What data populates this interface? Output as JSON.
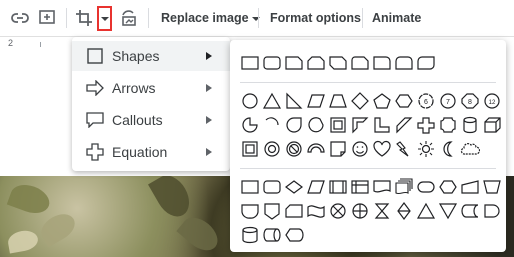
{
  "toolbar": {
    "replace_image": "Replace image",
    "format_options": "Format options",
    "animate": "Animate"
  },
  "ruler": {
    "number": "2"
  },
  "insert_menu": {
    "items": [
      {
        "label": "Shapes",
        "icon": "square-icon",
        "selected": true
      },
      {
        "label": "Arrows",
        "icon": "arrow-right-icon"
      },
      {
        "label": "Callouts",
        "icon": "callout-icon"
      },
      {
        "label": "Equation",
        "icon": "plus-icon"
      }
    ]
  },
  "shapes_submenu": {
    "groups": [
      "rectangles",
      "basic-shapes",
      "flowchart"
    ]
  }
}
